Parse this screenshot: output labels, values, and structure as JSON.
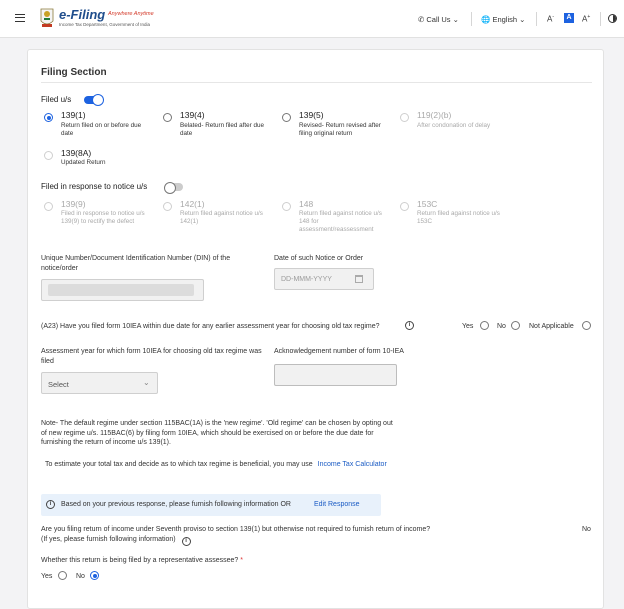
{
  "header": {
    "logo_title": "e-Filing",
    "logo_tagline": "Anywhere Anytime",
    "logo_subtitle": "Income Tax Department, Government of India",
    "call_us": "Call Us",
    "language": "English",
    "font_decrease": "A",
    "font_normal": "A",
    "font_increase": "A"
  },
  "filing": {
    "section_title": "Filing Section",
    "filed_us_label": "Filed u/s",
    "options": [
      {
        "code": "139(1)",
        "desc": "Return filed on or before due date"
      },
      {
        "code": "139(4)",
        "desc": "Belated- Return filed after due date"
      },
      {
        "code": "139(5)",
        "desc": "Revised- Return revised after filing original return"
      },
      {
        "code": "119(2)(b)",
        "desc": "After condonation of delay"
      },
      {
        "code": "139(8A)",
        "desc": "Updated Return"
      }
    ],
    "notice_label": "Filed in response to notice u/s",
    "notice_options": [
      {
        "code": "139(9)",
        "desc": "Filed in response to notice u/s 139(9) to rectify the defect"
      },
      {
        "code": "142(1)",
        "desc": "Return filed against notice u/s 142(1)"
      },
      {
        "code": "148",
        "desc": "Return filed against notice u/s 148 for assessment/reassessment"
      },
      {
        "code": "153C",
        "desc": "Return filed against notice u/s 153C"
      }
    ],
    "din_label": "Unique Number/Document Identification Number (DIN) of the notice/order",
    "notice_date_label": "Date of such Notice or Order",
    "notice_date_placeholder": "DD-MMM-YYYY"
  },
  "form10iea": {
    "question": "(A23) Have you filed form 10IEA within due date for any earlier assessment year for choosing old tax regime?",
    "yes": "Yes",
    "no": "No",
    "na": "Not Applicable",
    "ay_label": "Assessment year for which form 10IEA for choosing old tax regime was filed",
    "ay_select": "Select",
    "ack_label": "Acknowledgement number of form 10-IEA",
    "note": "Note- The default regime under section 115BAC(1A) is the 'new regime'. 'Old regime' can be chosen by opting out of new regime u/s. 115BAC(6) by filing form 10IEA, which should be exercised on or before the due date for furnishing the return of income u/s 139(1).",
    "estimate_text": "To estimate your total tax and decide as to which tax regime is beneficial, you may use",
    "calculator_link": "Income Tax Calculator"
  },
  "info_banner": {
    "text": "Based on your previous response, please furnish following information OR",
    "link": "Edit Response"
  },
  "seventh_proviso": {
    "question": "Are you filing return of income under Seventh proviso to section 139(1) but otherwise not required to furnish return of income? (If yes, please furnish following information)",
    "answer": "No"
  },
  "representative": {
    "question": "Whether this return is being filed by a representative assessee?",
    "required_mark": "*",
    "yes": "Yes",
    "no": "No"
  },
  "colors": {
    "accent": "#1d62e0",
    "link": "#1a5bc4",
    "banner_bg": "#e8f1fb"
  }
}
